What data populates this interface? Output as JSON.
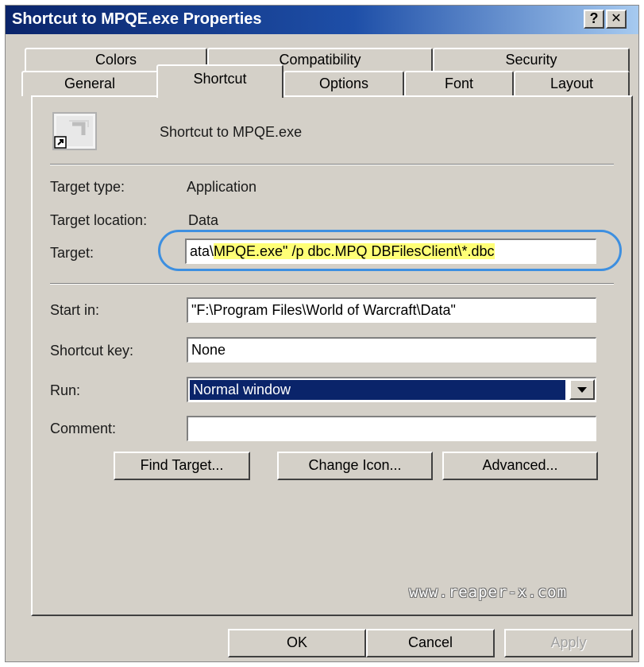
{
  "window": {
    "title": "Shortcut to MPQE.exe Properties",
    "help_button": "?",
    "close_button": "✕",
    "title_gradient": [
      "#0a246a",
      "#a6caf0"
    ]
  },
  "tabs": {
    "back_row": [
      "Colors",
      "Compatibility",
      "Security"
    ],
    "front_row": [
      "General",
      "Shortcut",
      "Options",
      "Font",
      "Layout"
    ],
    "active": "Shortcut"
  },
  "shortcut": {
    "icon": "shortcut-application-icon",
    "name": "Shortcut to MPQE.exe",
    "target_type_label": "Target type:",
    "target_type_value": "Application",
    "target_location_label": "Target location:",
    "target_location_value": "Data",
    "target_label": "Target:",
    "target_value_prefix": "ata\\",
    "target_value_highlight": "MPQE.exe\" /p dbc.MPQ DBFilesClient\\*.dbc",
    "target_highlight_color": "#ffff77",
    "target_callout_color": "#3d8fe0",
    "start_in_label": "Start in:",
    "start_in_value": "\"F:\\Program Files\\World of Warcraft\\Data\"",
    "shortcut_key_label": "Shortcut key:",
    "shortcut_key_value": "None",
    "run_label": "Run:",
    "run_value": "Normal window",
    "comment_label": "Comment:",
    "comment_value": ""
  },
  "buttons": {
    "find_target": "Find Target...",
    "change_icon": "Change Icon...",
    "advanced": "Advanced..."
  },
  "watermark": "www.reaper-x.com",
  "dialog_buttons": {
    "ok": "OK",
    "cancel": "Cancel",
    "apply": "Apply"
  }
}
